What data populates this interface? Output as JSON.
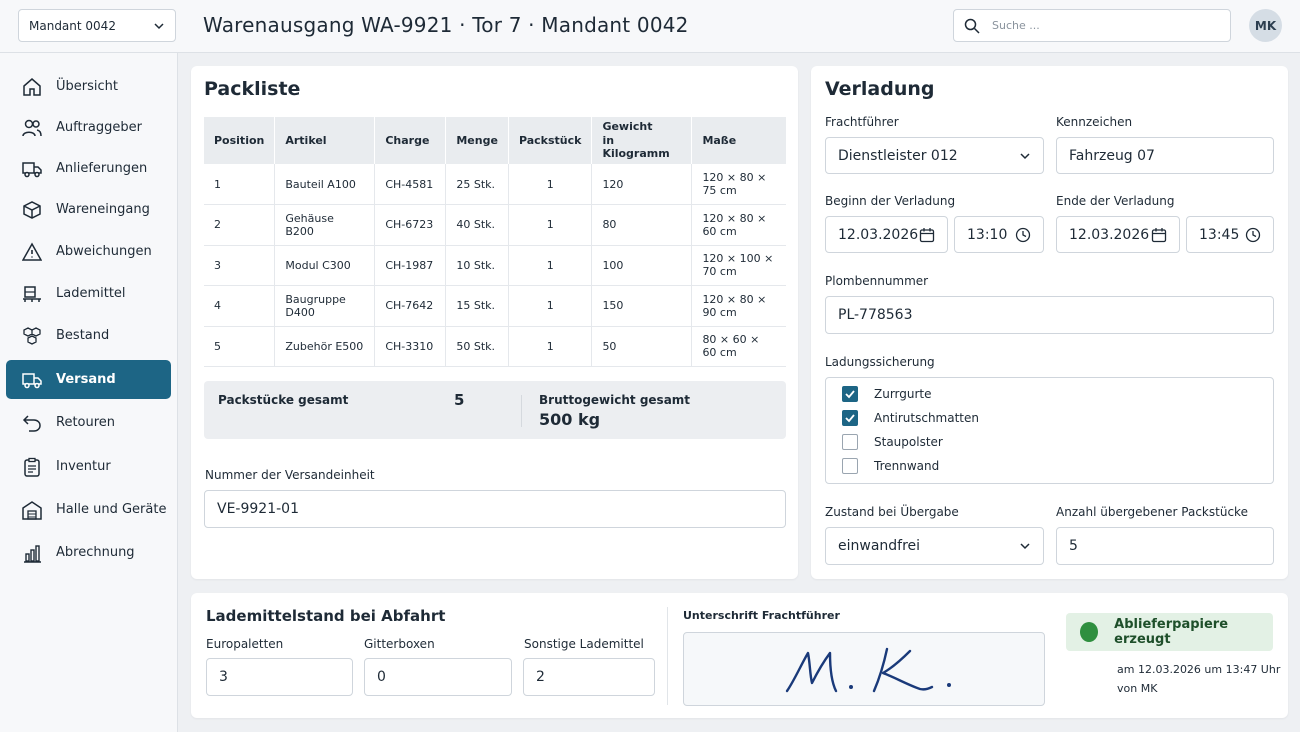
{
  "header": {
    "tenant": "Mandant 0042",
    "title": "Warenausgang WA-9921 · Tor 7 · Mandant 0042",
    "search_placeholder": "Suche ...",
    "user_initials": "MK"
  },
  "sidebar": {
    "items": [
      {
        "label": "Übersicht",
        "icon": "home-icon"
      },
      {
        "label": "Auftraggeber",
        "icon": "users-icon"
      },
      {
        "label": "Anlieferungen",
        "icon": "truck-icon"
      },
      {
        "label": "Wareneingang",
        "icon": "box-icon"
      },
      {
        "label": "Abweichungen",
        "icon": "warning-icon"
      },
      {
        "label": "Lademittel",
        "icon": "forklift-icon"
      },
      {
        "label": "Bestand",
        "icon": "stock-icon"
      },
      {
        "label": "Versand",
        "icon": "truck-icon"
      },
      {
        "label": "Retouren",
        "icon": "return-icon"
      },
      {
        "label": "Inventur",
        "icon": "clipboard-icon"
      },
      {
        "label": "Halle und Geräte",
        "icon": "warehouse-icon"
      },
      {
        "label": "Abrechnung",
        "icon": "bar-chart-icon"
      }
    ],
    "active": "Versand"
  },
  "packliste": {
    "title": "Packliste",
    "columns": [
      "Position",
      "Artikel",
      "Charge",
      "Menge",
      "Packstück",
      "Gewicht",
      "in Kilogramm",
      "Maße"
    ],
    "rows": [
      {
        "pos": "1",
        "artikel": "Bauteil A100",
        "charge": "CH-4581",
        "menge": "25 Stk.",
        "packstueck": "1",
        "gewicht": "120",
        "masse": "120 × 80 × 75 cm"
      },
      {
        "pos": "2",
        "artikel": "Gehäuse B200",
        "charge": "CH-6723",
        "menge": "40 Stk.",
        "packstueck": "1",
        "gewicht": "80",
        "masse": "120 × 80 × 60 cm"
      },
      {
        "pos": "3",
        "artikel": "Modul C300",
        "charge": "CH-1987",
        "menge": "10 Stk.",
        "packstueck": "1",
        "gewicht": "100",
        "masse": "120 × 100 × 70 cm"
      },
      {
        "pos": "4",
        "artikel": "Baugruppe D400",
        "charge": "CH-7642",
        "menge": "15 Stk.",
        "packstueck": "1",
        "gewicht": "150",
        "masse": "120 × 80 × 90 cm"
      },
      {
        "pos": "5",
        "artikel": "Zubehör E500",
        "charge": "CH-3310",
        "menge": "50 Stk.",
        "packstueck": "1",
        "gewicht": "50",
        "masse": "80 × 60 × 60 cm"
      }
    ],
    "totals": {
      "packstuecke_label": "Packstücke gesamt",
      "packstuecke_value": "5",
      "brutto_label": "Bruttogewicht gesamt",
      "brutto_value": "500 kg"
    },
    "unit_label": "Nummer der Versandeinheit",
    "unit_value": "VE-9921-01"
  },
  "verladung": {
    "title": "Verladung",
    "carrier_label": "Frachtführer",
    "carrier_value": "Dienstleister 012",
    "plate_label": "Kennzeichen",
    "plate_value": "Fahrzeug 07",
    "start_label": "Beginn der Verladung",
    "start_date": "12.03.2026",
    "start_time": "13:10",
    "end_label": "Ende der Verladung",
    "end_date": "12.03.2026",
    "end_time": "13:45",
    "seal_label": "Plombennummer",
    "seal_value": "PL-778563",
    "securing_label": "Ladungssicherung",
    "securing_options": [
      {
        "label": "Zurrgurte",
        "checked": true
      },
      {
        "label": "Antirutschmatten",
        "checked": true
      },
      {
        "label": "Staupolster",
        "checked": false
      },
      {
        "label": "Trennwand",
        "checked": false
      }
    ],
    "condition_label": "Zustand bei Übergabe",
    "condition_value": "einwandfrei",
    "handed_label": "Anzahl übergebener Packstücke",
    "handed_value": "5"
  },
  "lademittel": {
    "title": "Lademittelstand bei Abfahrt",
    "europaletten_label": "Europaletten",
    "europaletten_value": "3",
    "gitterboxen_label": "Gitterboxen",
    "gitterboxen_value": "0",
    "sonstige_label": "Sonstige Lademittel",
    "sonstige_value": "2"
  },
  "signature": {
    "label": "Unterschrift Frachtführer",
    "status": "Ablieferpapiere erzeugt",
    "status_color": "#2f8f3f",
    "meta_line1": "am 12.03.2026 um 13:47 Uhr",
    "meta_line2": "von MK"
  }
}
